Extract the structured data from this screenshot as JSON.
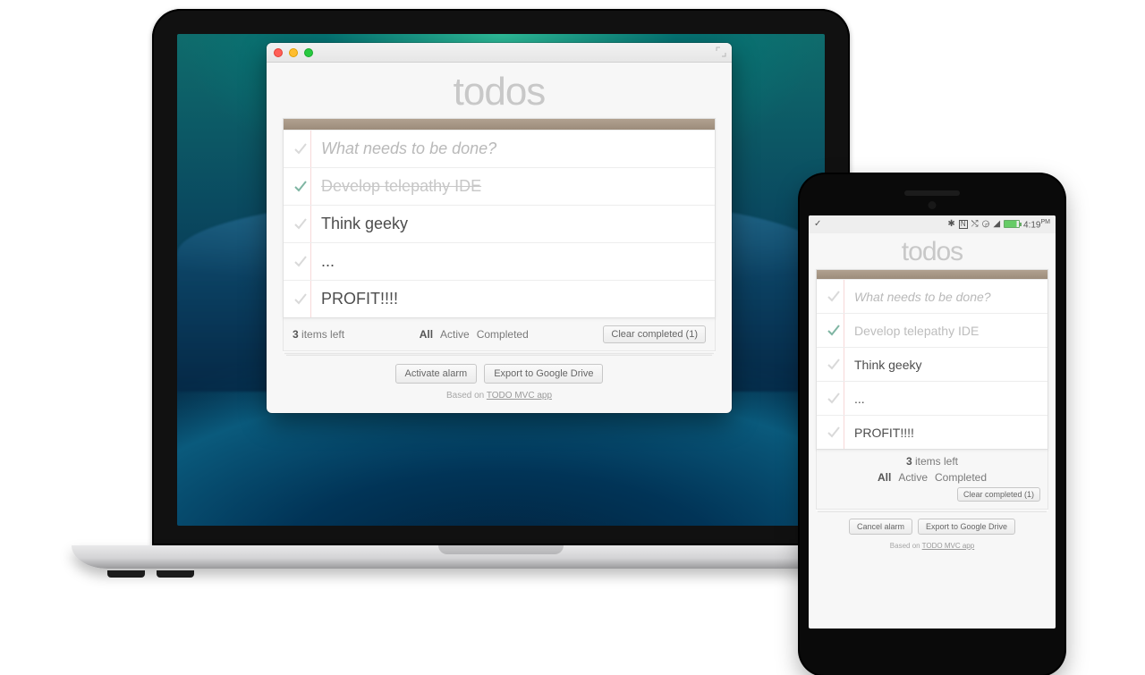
{
  "app_title": "todos",
  "input_placeholder": "What needs to be done?",
  "items": [
    {
      "text": "Develop telepathy IDE",
      "completed": true
    },
    {
      "text": "Think geeky",
      "completed": false
    },
    {
      "text": "...",
      "completed": false
    },
    {
      "text": "PROFIT!!!!",
      "completed": false
    }
  ],
  "footer": {
    "count_number": "3",
    "count_label": " items left",
    "filters": {
      "all": "All",
      "active": "Active",
      "completed": "Completed",
      "selected": "all"
    },
    "clear_label": "Clear completed (1)"
  },
  "desktop": {
    "alarm_button": "Activate alarm",
    "export_button": "Export to Google Drive"
  },
  "mobile": {
    "alarm_button": "Cancel alarm",
    "export_button": "Export to Google Drive",
    "statusbar": {
      "time": "4:19",
      "ampm": "PM"
    }
  },
  "credit": {
    "prefix": "Based on ",
    "link": "TODO MVC app"
  }
}
